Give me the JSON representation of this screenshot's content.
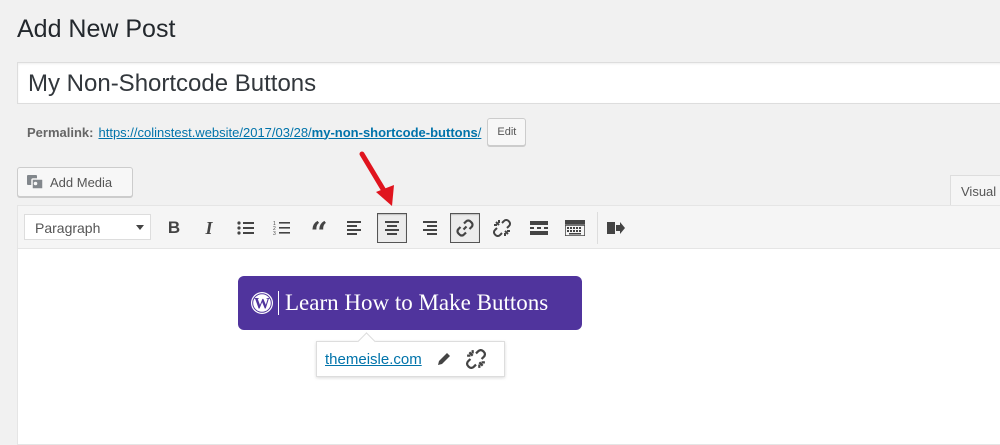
{
  "page": {
    "title": "Add New Post"
  },
  "post": {
    "title_value": "My Non-Shortcode Buttons"
  },
  "permalink": {
    "label": "Permalink:",
    "url_base": "https://colinstest.website/2017/03/28/",
    "slug": "my-non-shortcode-buttons",
    "url_trailing": "/",
    "edit_label": "Edit"
  },
  "media": {
    "add_media_label": "Add Media"
  },
  "editor_tabs": {
    "visual_label": "Visual"
  },
  "toolbar": {
    "format_value": "Paragraph",
    "buttons": [
      "bold",
      "italic",
      "bulleted-list",
      "numbered-list",
      "blockquote",
      "align-left",
      "align-center",
      "align-right",
      "insert-link",
      "remove-link",
      "read-more",
      "toolbar-toggle",
      "distraction-free"
    ],
    "active": [
      "align-center",
      "insert-link"
    ]
  },
  "content": {
    "button_label": "Learn How to Make Buttons",
    "button_color": "#50349d"
  },
  "link_tooltip": {
    "link_text": "themeisle.com"
  },
  "colors": {
    "accent": "#0073aa",
    "arrow": "#e0141e"
  }
}
